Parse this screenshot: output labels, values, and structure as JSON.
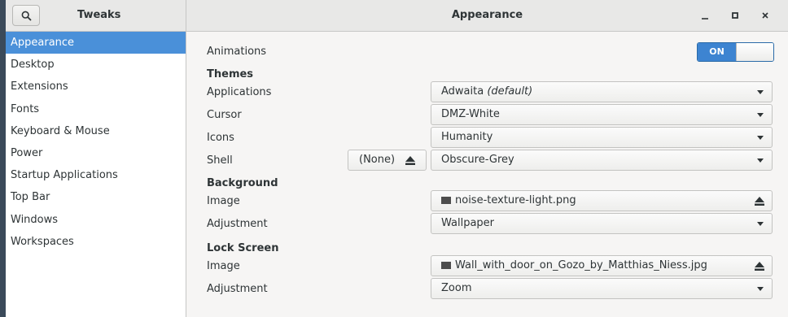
{
  "header": {
    "sidebar_title": "Tweaks",
    "window_title": "Appearance",
    "minimize_symbol": "_",
    "maximize_symbol": "□",
    "close_symbol": "✕"
  },
  "sidebar": {
    "items": [
      {
        "label": "Appearance",
        "selected": true
      },
      {
        "label": "Desktop"
      },
      {
        "label": "Extensions"
      },
      {
        "label": "Fonts"
      },
      {
        "label": "Keyboard & Mouse"
      },
      {
        "label": "Power"
      },
      {
        "label": "Startup Applications"
      },
      {
        "label": "Top Bar"
      },
      {
        "label": "Windows"
      },
      {
        "label": "Workspaces"
      }
    ]
  },
  "appearance": {
    "animations_label": "Animations",
    "animations_state": "ON",
    "themes_heading": "Themes",
    "applications_label": "Applications",
    "applications_value": "Adwaita",
    "applications_suffix": "(default)",
    "cursor_label": "Cursor",
    "cursor_value": "DMZ-White",
    "icons_label": "Icons",
    "icons_value": "Humanity",
    "shell_label": "Shell",
    "shell_none_label": "(None)",
    "shell_value": "Obscure-Grey",
    "background_heading": "Background",
    "bg_image_label": "Image",
    "bg_image_value": "noise-texture-light.png",
    "bg_adjustment_label": "Adjustment",
    "bg_adjustment_value": "Wallpaper",
    "lock_heading": "Lock Screen",
    "lock_image_label": "Image",
    "lock_image_value": "Wall_with_door_on_Gozo_by_Matthias_Niess.jpg",
    "lock_adjustment_label": "Adjustment",
    "lock_adjustment_value": "Zoom"
  },
  "colors": {
    "accent": "#4a90d9",
    "toggle_on": "#3d84d1"
  },
  "icons": [
    "search-icon",
    "minimize-icon",
    "maximize-icon",
    "close-icon",
    "eject-icon",
    "file-icon",
    "dropdown-arrow-icon"
  ]
}
